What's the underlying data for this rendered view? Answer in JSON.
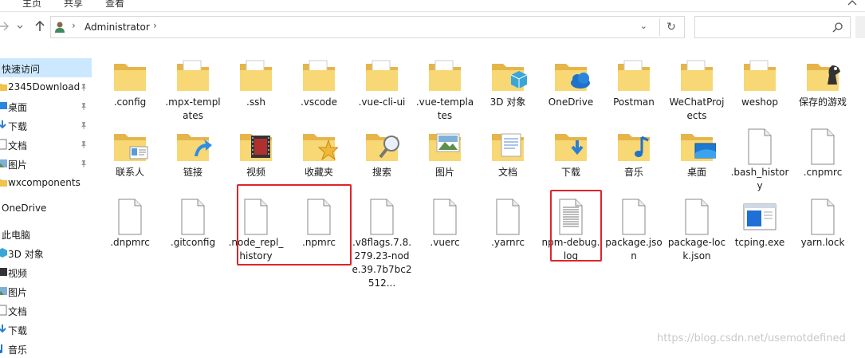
{
  "ribbon": {
    "tabs": [
      "主页",
      "共享",
      "查看"
    ]
  },
  "address": {
    "crumb": "Administrator"
  },
  "sidebar": {
    "items": [
      {
        "label": "快速访问",
        "kind": "header",
        "icon": "star-icon",
        "selected": true
      },
      {
        "label": "2345Download",
        "icon": "folder-icon",
        "pinned": true
      },
      {
        "label": "桌面",
        "icon": "desktop-icon",
        "pinned": true
      },
      {
        "label": "下载",
        "icon": "download-icon",
        "pinned": true
      },
      {
        "label": "文档",
        "icon": "document-icon",
        "pinned": true
      },
      {
        "label": "图片",
        "icon": "picture-icon",
        "pinned": true
      },
      {
        "label": "wxcomponents",
        "icon": "folder-icon",
        "pinned": false
      },
      {
        "label": "OneDrive",
        "kind": "header",
        "icon": "cloud-icon"
      },
      {
        "label": "此电脑",
        "kind": "header",
        "icon": "computer-icon"
      },
      {
        "label": "3D 对象",
        "icon": "cube-icon"
      },
      {
        "label": "视频",
        "icon": "video-icon"
      },
      {
        "label": "图片",
        "icon": "picture-icon"
      },
      {
        "label": "文档",
        "icon": "document-icon"
      },
      {
        "label": "下载",
        "icon": "download-icon"
      },
      {
        "label": "音乐",
        "icon": "music-icon"
      }
    ]
  },
  "files": [
    {
      "name": ".config",
      "type": "folder"
    },
    {
      "name": ".mpx-templates",
      "type": "folder-doc"
    },
    {
      "name": ".ssh",
      "type": "folder-white"
    },
    {
      "name": ".vscode",
      "type": "folder-white"
    },
    {
      "name": ".vue-cli-ui",
      "type": "folder-white"
    },
    {
      "name": ".vue-templates",
      "type": "folder-doc"
    },
    {
      "name": "3D 对象",
      "type": "folder-3d"
    },
    {
      "name": "OneDrive",
      "type": "folder-cloud"
    },
    {
      "name": "Postman",
      "type": "folder-doc"
    },
    {
      "name": "WeChatProjects",
      "type": "folder-doc"
    },
    {
      "name": "weshop",
      "type": "folder-doc"
    },
    {
      "name": "保存的游戏",
      "type": "folder-games"
    },
    {
      "name": "联系人",
      "type": "folder-contacts"
    },
    {
      "name": "链接",
      "type": "folder-link"
    },
    {
      "name": "视频",
      "type": "folder-video"
    },
    {
      "name": "收藏夹",
      "type": "folder-star"
    },
    {
      "name": "搜索",
      "type": "folder-search"
    },
    {
      "name": "图片",
      "type": "folder-picture"
    },
    {
      "name": "文档",
      "type": "folder-document"
    },
    {
      "name": "下载",
      "type": "folder-download"
    },
    {
      "name": "音乐",
      "type": "folder-music"
    },
    {
      "name": "桌面",
      "type": "folder-desktop"
    },
    {
      "name": ".bash_history",
      "type": "file"
    },
    {
      "name": ".cnpmrc",
      "type": "file"
    },
    {
      "name": ".dnpmrc",
      "type": "file"
    },
    {
      "name": ".gitconfig",
      "type": "file"
    },
    {
      "name": ".node_repl_history",
      "type": "file"
    },
    {
      "name": ".npmrc",
      "type": "file"
    },
    {
      "name": ".v8flags.7.8.279.23-node.39.7b7bc2512...",
      "type": "file"
    },
    {
      "name": ".vuerc",
      "type": "file"
    },
    {
      "name": ".yarnrc",
      "type": "file"
    },
    {
      "name": "npm-debug.log",
      "type": "text-file"
    },
    {
      "name": "package.json",
      "type": "file"
    },
    {
      "name": "package-lock.json",
      "type": "file"
    },
    {
      "name": "tcping.exe",
      "type": "exe"
    },
    {
      "name": "yarn.lock",
      "type": "file"
    }
  ],
  "watermark": "https://blog.csdn.net/usemotdefined",
  "colors": {
    "folder": "#f8d775",
    "folder_dark": "#e6b54a",
    "selection": "#cce8ff",
    "highlight_box": "#e0242a"
  }
}
